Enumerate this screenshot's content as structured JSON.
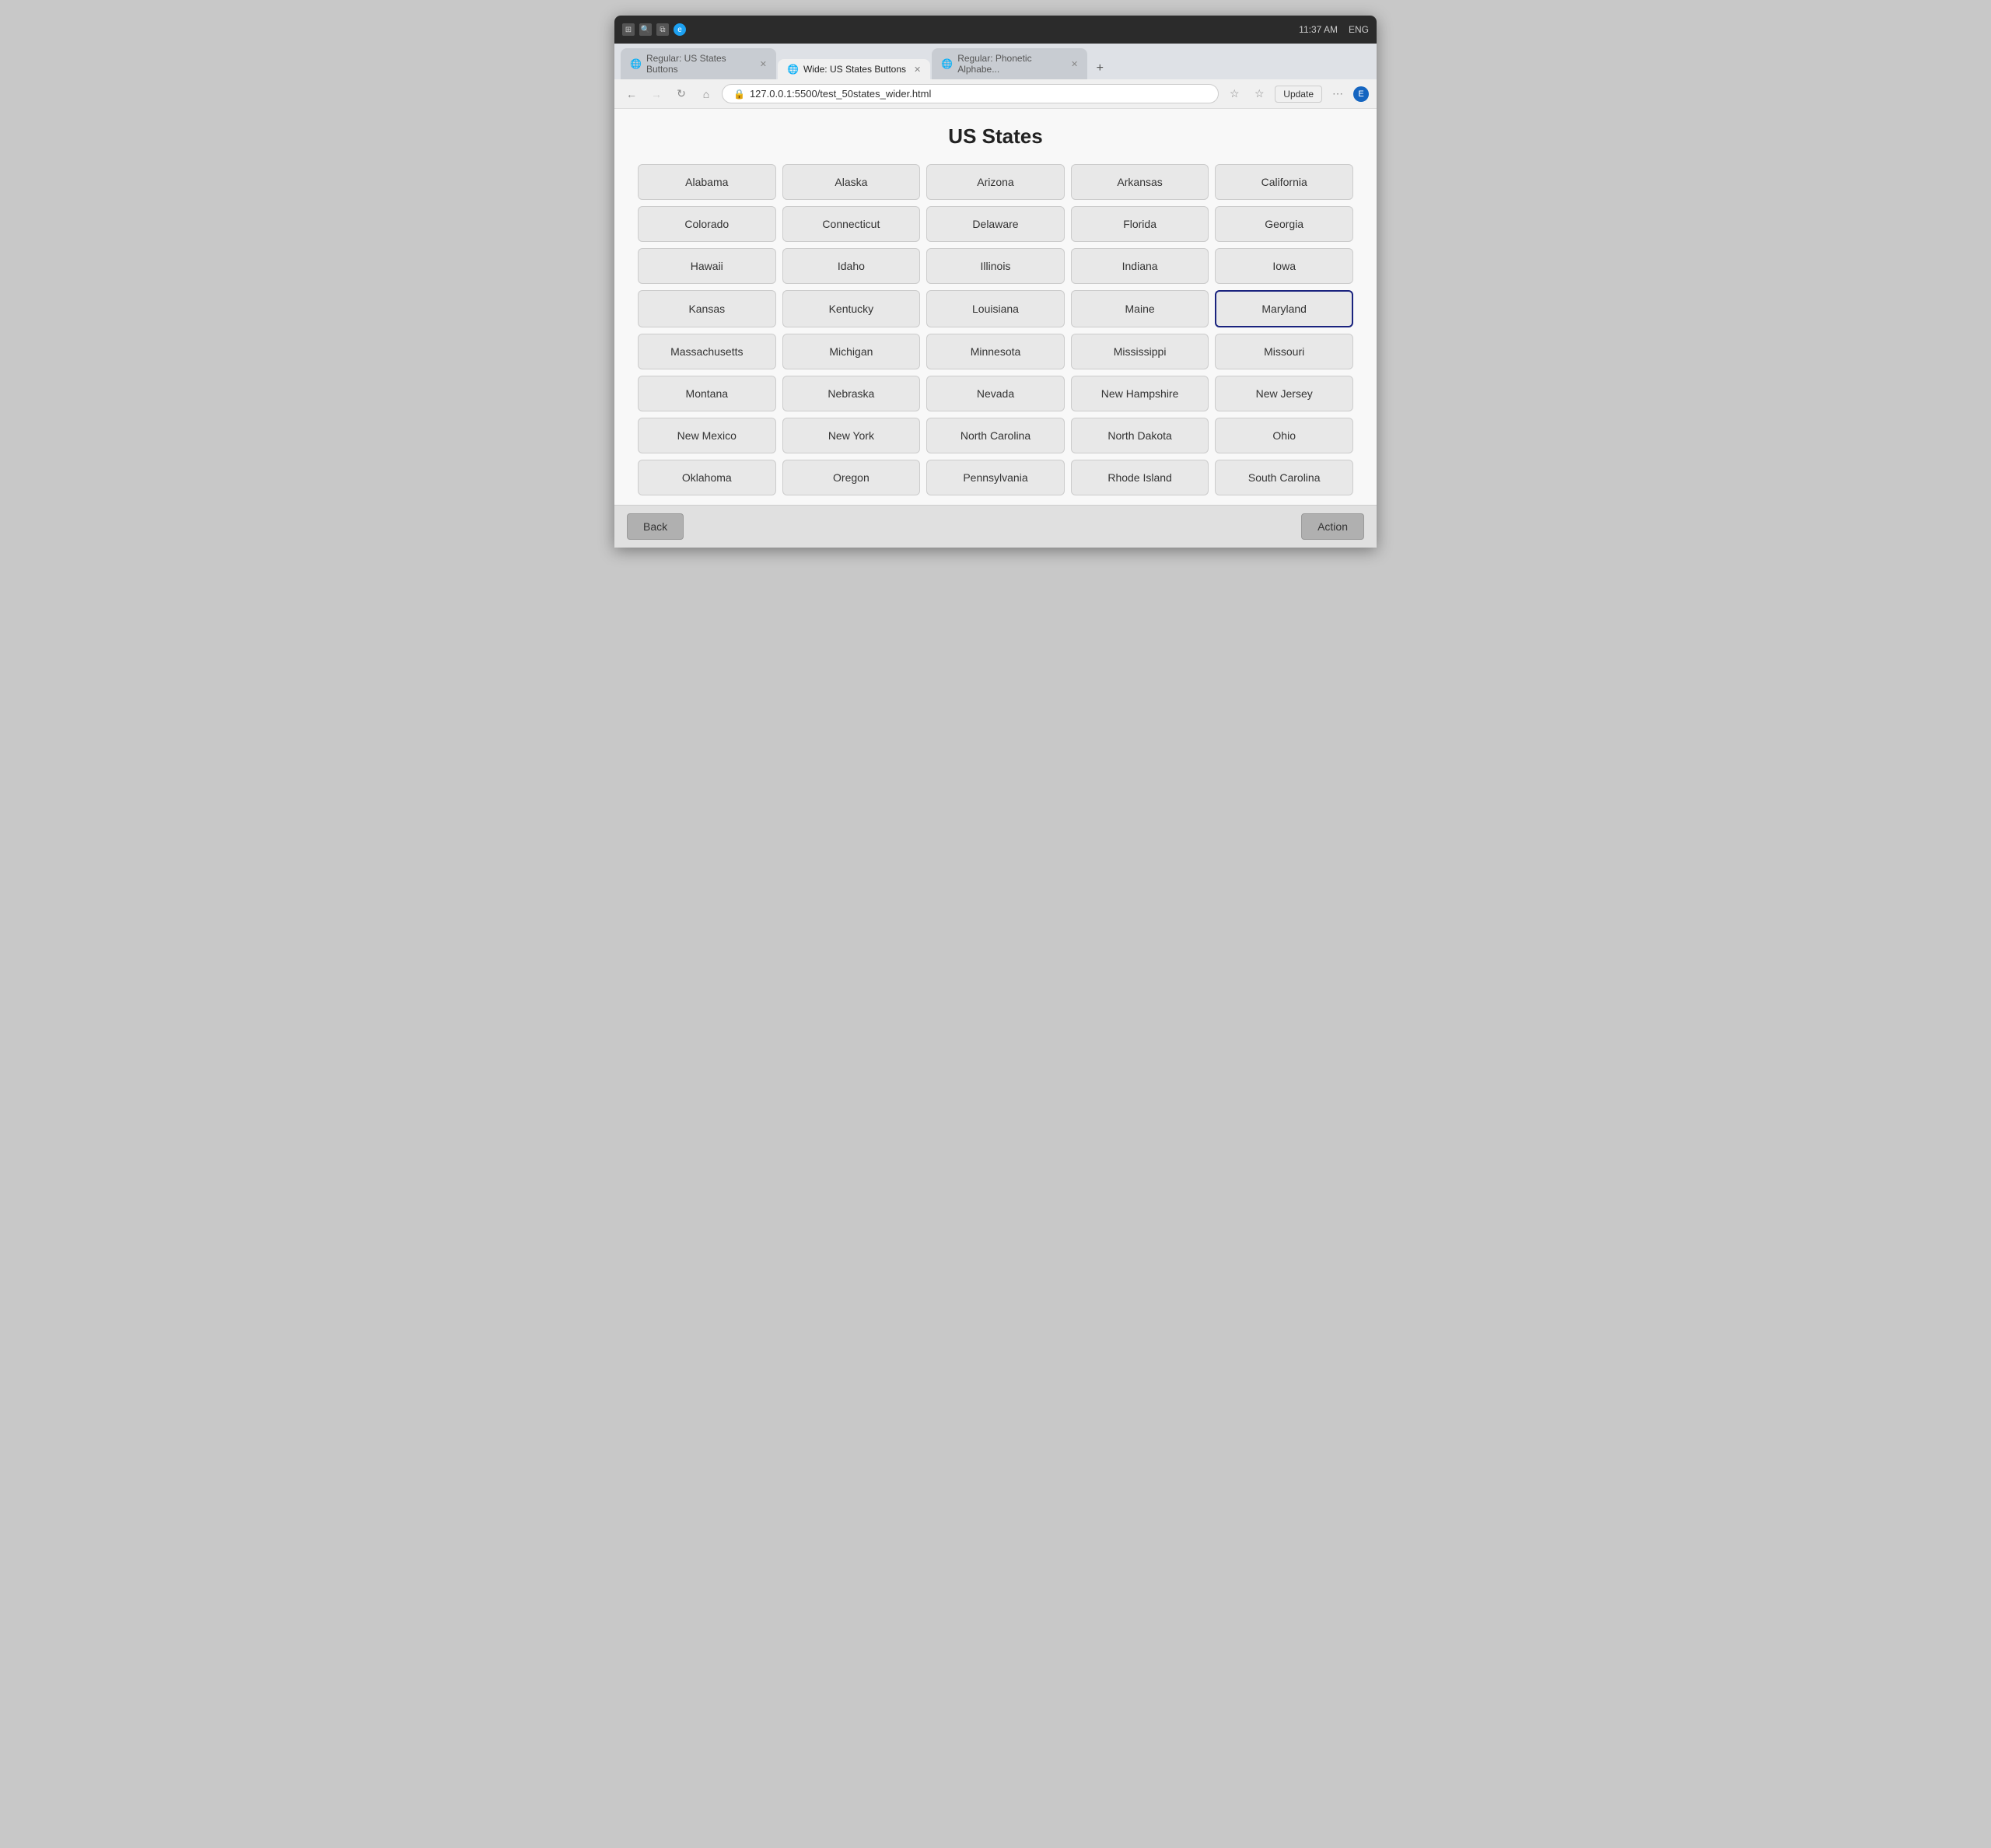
{
  "browser": {
    "titlebar": {
      "time": "11:37 AM",
      "lang": "ENG"
    },
    "tabs": [
      {
        "id": "tab1",
        "label": "Regular: US States Buttons",
        "active": false,
        "icon": "globe"
      },
      {
        "id": "tab2",
        "label": "Wide: US States Buttons",
        "active": true,
        "icon": "globe"
      },
      {
        "id": "tab3",
        "label": "Regular: Phonetic Alphabe...",
        "active": false,
        "icon": "globe"
      }
    ],
    "url": "127.0.0.1:5500/test_50states_wider.html",
    "update_btn": "Update"
  },
  "page": {
    "title": "US States",
    "states": [
      "Alabama",
      "Alaska",
      "Arizona",
      "Arkansas",
      "California",
      "Colorado",
      "Connecticut",
      "Delaware",
      "Florida",
      "Georgia",
      "Hawaii",
      "Idaho",
      "Illinois",
      "Indiana",
      "Iowa",
      "Kansas",
      "Kentucky",
      "Louisiana",
      "Maine",
      "Maryland",
      "Massachusetts",
      "Michigan",
      "Minnesota",
      "Mississippi",
      "Missouri",
      "Montana",
      "Nebraska",
      "Nevada",
      "New Hampshire",
      "New Jersey",
      "New Mexico",
      "New York",
      "North Carolina",
      "North Dakota",
      "Ohio",
      "Oklahoma",
      "Oregon",
      "Pennsylvania",
      "Rhode Island",
      "South Carolina"
    ],
    "selected_state": "Maryland",
    "back_btn": "Back",
    "action_btn": "Action"
  }
}
